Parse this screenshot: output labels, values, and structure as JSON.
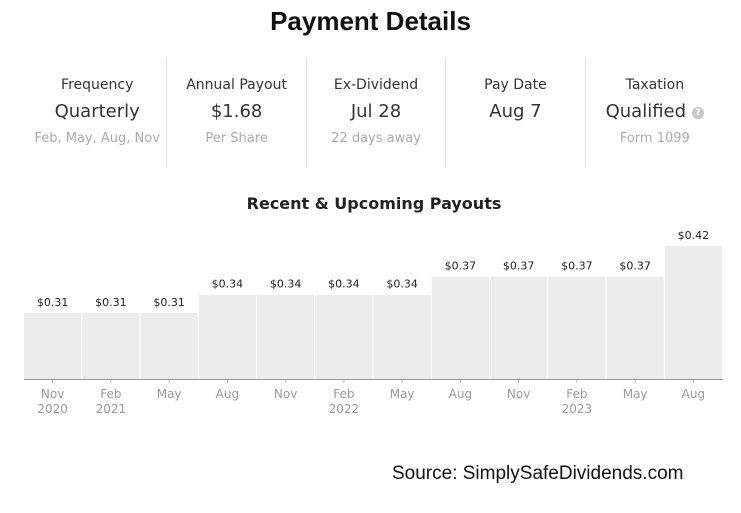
{
  "title": "Payment Details",
  "stats": [
    {
      "label": "Frequency",
      "value": "Quarterly",
      "sub": "Feb, May, Aug, Nov"
    },
    {
      "label": "Annual Payout",
      "value": "$1.68",
      "sub": "Per Share"
    },
    {
      "label": "Ex-Dividend",
      "value": "Jul 28",
      "sub": "22 days away"
    },
    {
      "label": "Pay Date",
      "value": "Aug 7",
      "sub": ""
    },
    {
      "label": "Taxation",
      "value": "Qualified",
      "sub": "Form 1099",
      "icon": "question-circle-icon"
    }
  ],
  "chart_data": {
    "type": "bar",
    "title": "Recent & Upcoming Payouts",
    "categories": [
      "Nov 2020",
      "Feb 2021",
      "May",
      "Aug",
      "Nov",
      "Feb 2022",
      "May",
      "Aug",
      "Nov",
      "Feb 2023",
      "May",
      "Aug"
    ],
    "tick_lines": [
      [
        "Nov",
        "2020"
      ],
      [
        "Feb",
        "2021"
      ],
      [
        "May"
      ],
      [
        "Aug"
      ],
      [
        "Nov"
      ],
      [
        "Feb",
        "2022"
      ],
      [
        "May"
      ],
      [
        "Aug"
      ],
      [
        "Nov"
      ],
      [
        "Feb",
        "2023"
      ],
      [
        "May"
      ],
      [
        "Aug"
      ]
    ],
    "values": [
      0.31,
      0.31,
      0.31,
      0.34,
      0.34,
      0.34,
      0.34,
      0.37,
      0.37,
      0.37,
      0.37,
      0.42
    ],
    "labels": [
      "$0.31",
      "$0.31",
      "$0.31",
      "$0.34",
      "$0.34",
      "$0.34",
      "$0.34",
      "$0.37",
      "$0.37",
      "$0.37",
      "$0.37",
      "$0.42"
    ],
    "bar_color": "#ececec",
    "highlight_color": "#eeeeee",
    "grid": false
  },
  "source": "Source: SimplySafeDividends.com"
}
